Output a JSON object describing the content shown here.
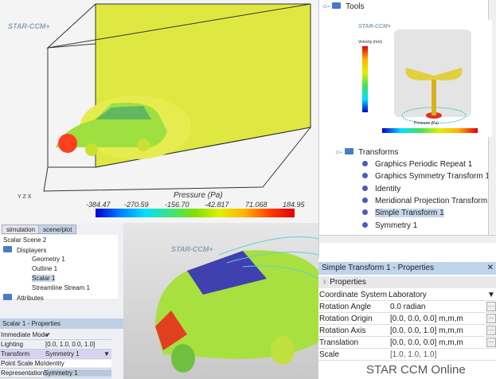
{
  "view1": {
    "logo": "STAR-CCM+",
    "legend_title": "Pressure (Pa)",
    "ticks": [
      "-384.47",
      "-270.59",
      "-156.70",
      "-42.817",
      "71.068",
      "184.95"
    ],
    "axes": [
      "Y",
      "Z",
      "X"
    ]
  },
  "tree": {
    "tools": "Tools",
    "transforms": "Transforms",
    "items": [
      "Graphics Periodic Repeat 1",
      "Graphics Symmetry Transform 1",
      "Identity",
      "Meridional Projection Transform 1",
      "Simple Transform 1",
      "Symmetry 1"
    ],
    "selected": "Simple Transform 1"
  },
  "inset": {
    "logo": "STAR-CCM+",
    "velocity_title": "Velocity (m/s)",
    "pressure_title": "Pressure (Pa)"
  },
  "left": {
    "tabs": [
      "simulation",
      "scene/plot"
    ],
    "scene": "Scalar Scene 2",
    "displayers": "Displayers",
    "children": [
      "Geometry 1",
      "Outline 1",
      "Scalar 1",
      "Streamline Stream 1"
    ],
    "attributes": "Attributes",
    "props_title": "Scalar 1 - Properties",
    "props": [
      {
        "k": "Immediate Mode",
        "v": "✔"
      },
      {
        "k": "Lighting",
        "v": "[0.0, 1.0, 0.0, 1.0]"
      },
      {
        "k": "Transform",
        "v": "Symmetry 1"
      },
      {
        "k": "Point Scale Mode",
        "v": "Identity"
      },
      {
        "k": "Representation",
        "v": "Symmetry 1"
      }
    ]
  },
  "car": {
    "logo": "STAR-CCM+"
  },
  "props": {
    "title": "Simple Transform 1 - Properties",
    "section": "Properties",
    "rows": [
      {
        "k": "Coordinate System",
        "v": "Laboratory"
      },
      {
        "k": "Rotation Angle",
        "v": "0.0 radian"
      },
      {
        "k": "Rotation Origin",
        "v": "[0.0, 0.0, 0.0] m,m,m"
      },
      {
        "k": "Rotation Axis",
        "v": "[0.0, 0.0, 1.0] m,m,m"
      },
      {
        "k": "Translation",
        "v": "[0.0, 0.0, 0.0] m,m,m"
      },
      {
        "k": "Scale",
        "v": "[1.0, 1.0, 1.0]"
      }
    ],
    "watermark": "STAR CCM Online"
  }
}
